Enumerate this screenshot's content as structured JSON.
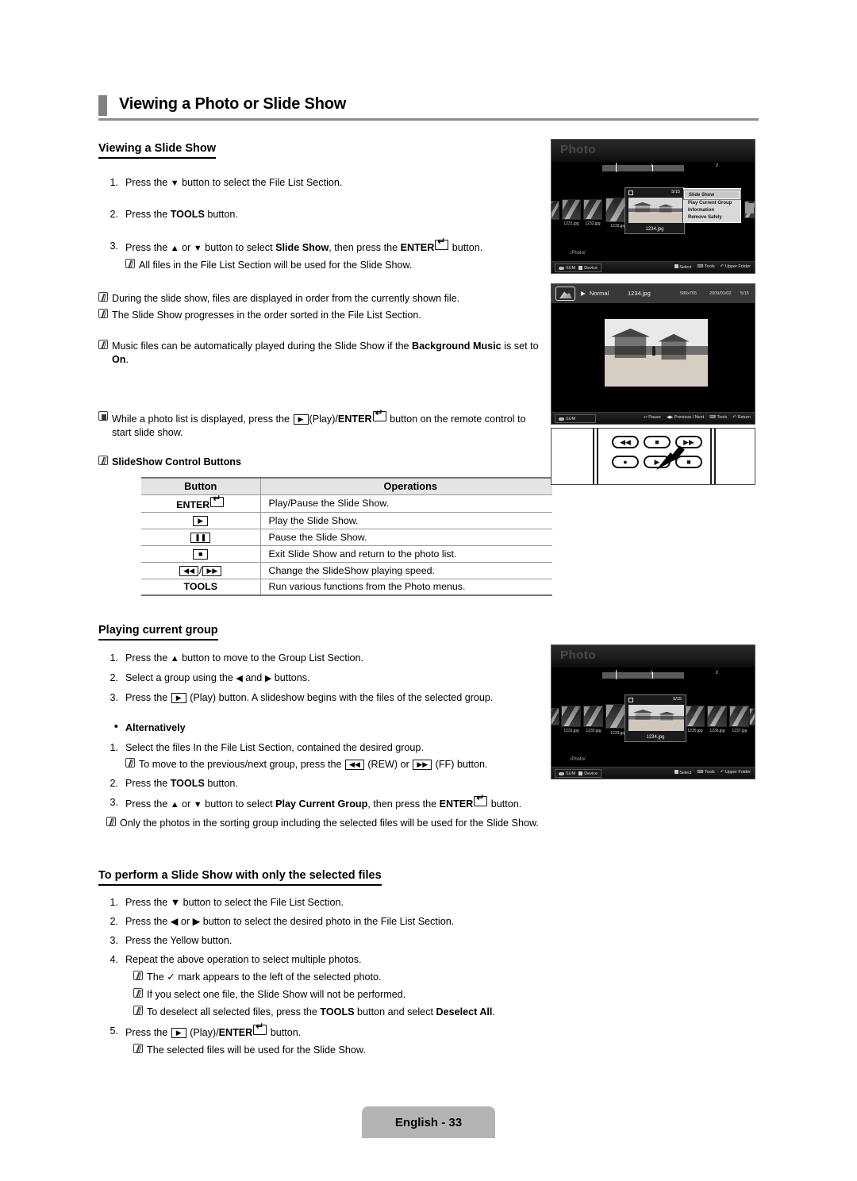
{
  "page": {
    "title": "Viewing a Photo or Slide Show",
    "footer_label": "English - 33"
  },
  "sections": {
    "viewing_slide_show": {
      "heading": "Viewing a Slide Show",
      "steps": [
        {
          "num": "1.",
          "pre": "Press the ",
          "key": "▼",
          "post": " button to select the File List Section."
        },
        {
          "num": "2.",
          "pre": "Press the ",
          "bold": "TOOLS",
          "post": " button."
        },
        {
          "num": "3.",
          "text": "Press the ▲ or ▼ button to select Slide Show, then press the ENTER button."
        }
      ],
      "step3_note": "All files in the File List Section will be used for the Slide Show.",
      "notes": [
        "During the slide show, files are displayed in order from the currently shown file.",
        "The Slide Show progresses in the order sorted in the File List Section.",
        "Music files can be automatically played during the Slide Show if the Background Music is set to On."
      ],
      "hand_note_line1": "While a photo list is displayed, press the",
      "hand_note_play": "(Play)/",
      "hand_note_enter": "ENTER",
      "hand_note_line1_end": "button on the",
      "hand_note_line2": "remote control to start slide show.",
      "controls_title": "SlideShow Control Buttons"
    },
    "control_table": {
      "headers": [
        "Button",
        "Operations"
      ],
      "rows": [
        {
          "button": "ENTER",
          "button_type": "enter",
          "operation": "Play/Pause the Slide Show."
        },
        {
          "button": "▶",
          "button_type": "key",
          "operation": "Play the Slide Show."
        },
        {
          "button": "❚❚",
          "button_type": "key",
          "operation": "Pause the Slide Show."
        },
        {
          "button": "■",
          "button_type": "key",
          "operation": "Exit Slide Show and return to the photo list."
        },
        {
          "button": "◀◀/▶▶",
          "button_type": "keypair",
          "operation": "Change the SlideShow playing speed."
        },
        {
          "button": "TOOLS",
          "button_type": "text",
          "operation": "Run various functions from the Photo menus."
        }
      ]
    },
    "playing_current_group": {
      "heading": "Playing current group",
      "steps": [
        "Press the ▲ button to move to the Group List Section.",
        "Select a group using the ◀ and ▶ buttons.",
        "Press the (Play) button. A slideshow begins with the files of the selected group."
      ],
      "alternatively_label": "Alternatively",
      "alt_steps": [
        "Select the files In the File List Section, contained the desired group.",
        "Press the TOOLS button.",
        "Press the ▲ or ▼ button to select Play Current Group, then press the ENTER button."
      ],
      "alt_note_rew_ff_a": "To move to the previous/next group, press the",
      "alt_note_rew": "(REW) or",
      "alt_note_ff": "(FF)",
      "alt_note_button": "button.",
      "final_note": "Only the photos in the sorting group including the selected files will be used for the Slide Show."
    },
    "selected_files": {
      "heading": "To perform a Slide Show with only the selected files",
      "steps": [
        "Press the ▼ button to select the File List Section.",
        "Press the ◀ or ▶ button to select the desired photo in the File List Section.",
        "Press the Yellow button.",
        "Repeat the above operation to select multiple photos.",
        "Press the (Play)/ENTER button."
      ],
      "notes_step4": [
        "The ✓ mark appears to the left of the selected photo.",
        "If you select one file, the Slide Show will not be performed.",
        "To deselect all selected files, press the TOOLS button and select Deselect All."
      ],
      "notes_step5": [
        "The selected files will be used for the Slide Show."
      ]
    }
  },
  "screenshots": {
    "photo_browser_tools": {
      "screen_title": "Photo",
      "group_labels": [
        "1",
        "2"
      ],
      "thumbnails": [
        "1231.jpg",
        "1232.jpg",
        "1233.jpg"
      ],
      "selected_file": "1234.jpg",
      "selected_count": "5/15",
      "path": "./Photo/",
      "device_left": [
        "SUM",
        "Device"
      ],
      "bottom_actions": [
        "Select",
        "Tools",
        "Upper Folder"
      ],
      "tools_menu": [
        "Slide Show",
        "Play Current Group",
        "Information",
        "Remove Safely"
      ],
      "tools_menu_selected": "Slide Show"
    },
    "photo_viewer": {
      "mode": "Normal",
      "filename": "1234.jpg",
      "resolution": "580x765",
      "date": "2009/01/02",
      "index": "5/15",
      "device_left": "SUM",
      "bottom_actions": [
        "Pause",
        "Previous / Next",
        "Tools",
        "Return"
      ]
    },
    "remote_control": {
      "buttons_top": [
        "rewind",
        "pause",
        "fast-forward"
      ],
      "buttons_bottom": [
        "record",
        "play",
        "stop"
      ]
    },
    "photo_browser_group": {
      "screen_title": "Photo",
      "group_labels": [
        "1",
        "2"
      ],
      "thumbnails_left": [
        "1231.jpg",
        "1232.jpg",
        "1233.jpg"
      ],
      "thumbnails_right": [
        "1235.jpg",
        "1236.jpg",
        "1237.jpg"
      ],
      "selected_file": "1234.jpg",
      "selected_count": "5/15",
      "path": "./Photo/",
      "device_left": [
        "SUM",
        "Device"
      ],
      "bottom_actions": [
        "Select",
        "Tools",
        "Upper Folder"
      ]
    }
  }
}
